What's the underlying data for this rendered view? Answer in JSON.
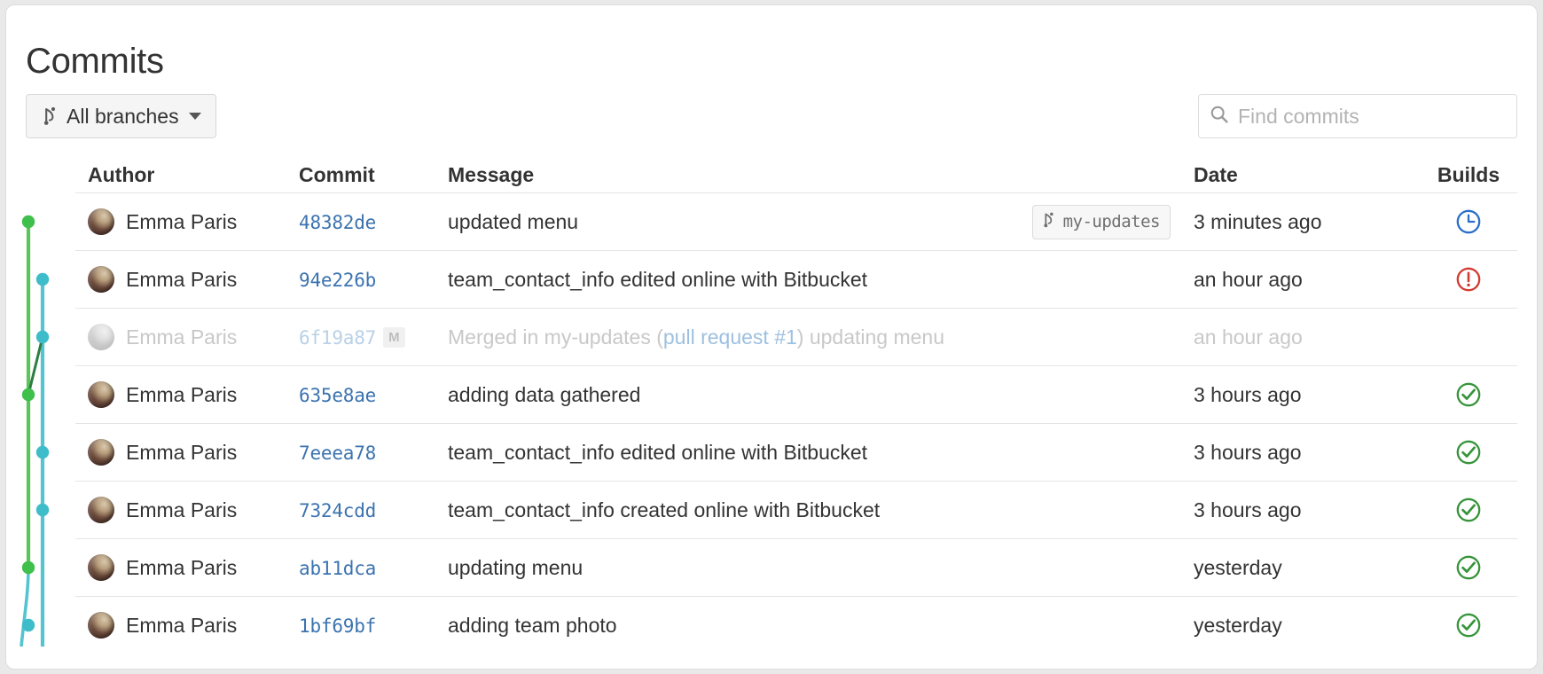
{
  "page": {
    "title": "Commits"
  },
  "toolbar": {
    "branch_filter_label": "All branches",
    "branch_icon": "branch-icon",
    "caret_icon": "chevron-down-icon",
    "search": {
      "placeholder": "Find commits",
      "value": "",
      "icon": "search-icon"
    }
  },
  "table": {
    "columns": {
      "author": "Author",
      "commit": "Commit",
      "message": "Message",
      "date": "Date",
      "builds": "Builds"
    },
    "rows": [
      {
        "author": "Emma Paris",
        "hash": "48382de",
        "message": "updated menu",
        "message_link": "",
        "message_suffix": "",
        "ref_tag": "my-updates",
        "merge_badge": "",
        "date": "3 minutes ago",
        "build": "pending",
        "build_icon": "clock-icon",
        "build_color": "#2a6fc9",
        "dimmed": false
      },
      {
        "author": "Emma Paris",
        "hash": "94e226b",
        "message": "team_contact_info edited online with Bitbucket",
        "message_link": "",
        "message_suffix": "",
        "ref_tag": "",
        "merge_badge": "",
        "date": "an hour ago",
        "build": "failed",
        "build_icon": "exclamation-circle-icon",
        "build_color": "#d13b32",
        "dimmed": false
      },
      {
        "author": "Emma Paris",
        "hash": "6f19a87",
        "message": "Merged in my-updates (",
        "message_link": "pull request #1",
        "message_suffix": ") updating menu",
        "ref_tag": "",
        "merge_badge": "M",
        "date": "an hour ago",
        "build": "none",
        "build_icon": "",
        "build_color": "",
        "dimmed": true
      },
      {
        "author": "Emma Paris",
        "hash": "635e8ae",
        "message": "adding data gathered",
        "message_link": "",
        "message_suffix": "",
        "ref_tag": "",
        "merge_badge": "",
        "date": "3 hours ago",
        "build": "successful",
        "build_icon": "check-circle-icon",
        "build_color": "#36943a",
        "dimmed": false
      },
      {
        "author": "Emma Paris",
        "hash": "7eeea78",
        "message": "team_contact_info edited online with Bitbucket",
        "message_link": "",
        "message_suffix": "",
        "ref_tag": "",
        "merge_badge": "",
        "date": "3 hours ago",
        "build": "successful",
        "build_icon": "check-circle-icon",
        "build_color": "#36943a",
        "dimmed": false
      },
      {
        "author": "Emma Paris",
        "hash": "7324cdd",
        "message": "team_contact_info created online with Bitbucket",
        "message_link": "",
        "message_suffix": "",
        "ref_tag": "",
        "merge_badge": "",
        "date": "3 hours ago",
        "build": "successful",
        "build_icon": "check-circle-icon",
        "build_color": "#36943a",
        "dimmed": false
      },
      {
        "author": "Emma Paris",
        "hash": "ab11dca",
        "message": "updating menu",
        "message_link": "",
        "message_suffix": "",
        "ref_tag": "",
        "merge_badge": "",
        "date": "yesterday",
        "build": "successful",
        "build_icon": "check-circle-icon",
        "build_color": "#36943a",
        "dimmed": false
      },
      {
        "author": "Emma Paris",
        "hash": "1bf69bf",
        "message": "adding team photo",
        "message_link": "",
        "message_suffix": "",
        "ref_tag": "",
        "merge_badge": "",
        "date": "yesterday",
        "build": "successful",
        "build_icon": "check-circle-icon",
        "build_color": "#36943a",
        "dimmed": false
      }
    ]
  },
  "graph": {
    "lane_colors": {
      "green": "#5bc45b",
      "teal": "#54c4d0"
    },
    "nodes": [
      {
        "row": 0,
        "lane": "green"
      },
      {
        "row": 1,
        "lane": "teal"
      },
      {
        "row": 2,
        "lane": "teal"
      },
      {
        "row": 3,
        "lane": "green"
      },
      {
        "row": 4,
        "lane": "teal"
      },
      {
        "row": 5,
        "lane": "teal"
      },
      {
        "row": 6,
        "lane": "green"
      },
      {
        "row": 7,
        "lane": "teal"
      }
    ]
  }
}
